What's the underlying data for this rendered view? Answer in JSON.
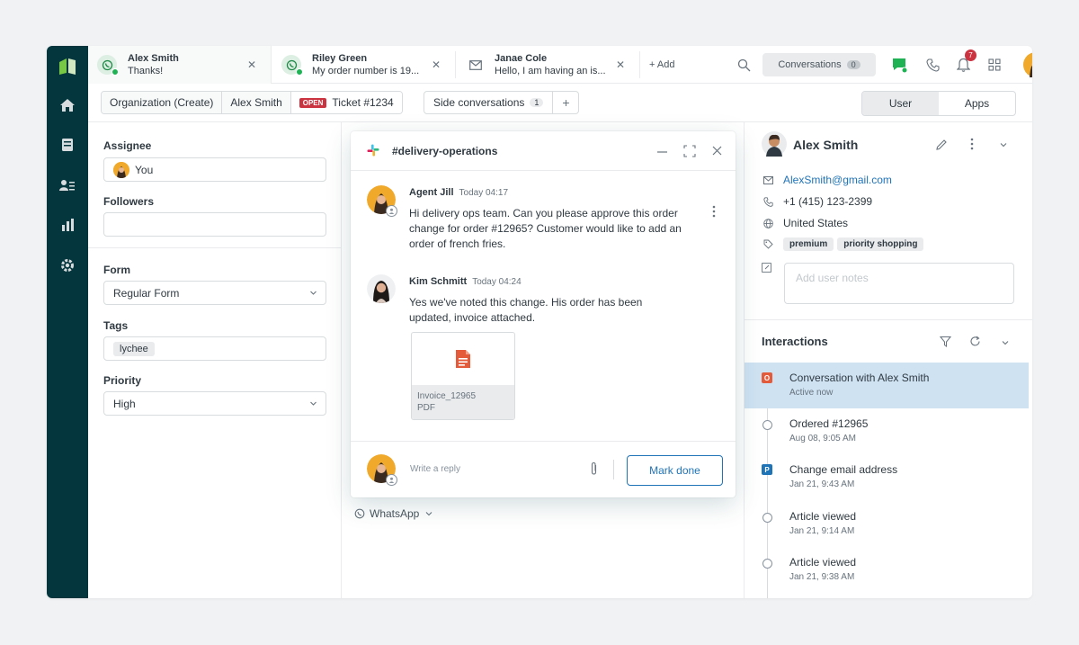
{
  "colors": {
    "rail": "#03363d",
    "accent": "#1f73b7",
    "danger": "#cc3340",
    "whatsapp": "#1fb254",
    "active_row": "#cee2f2"
  },
  "tabs": [
    {
      "name": "Alex Smith",
      "preview": "Thanks!",
      "icon": "whatsapp-icon"
    },
    {
      "name": "Riley Green",
      "preview": "My order number is 19...",
      "icon": "whatsapp-icon"
    },
    {
      "name": "Janae Cole",
      "preview": "Hello, I am having an is...",
      "icon": "mail-icon"
    }
  ],
  "topbar": {
    "add_label": "+ Add",
    "conversations_label": "Conversations",
    "conversations_count": "0",
    "notifications_count": "7"
  },
  "breadcrumb": {
    "org": "Organization (Create)",
    "user": "Alex Smith",
    "status": "OPEN",
    "ticket": "Ticket #1234"
  },
  "side_conversations": {
    "label": "Side conversations",
    "count": "1",
    "plus": "+"
  },
  "segmented": {
    "user": "User",
    "apps": "Apps"
  },
  "left": {
    "assignee_label": "Assignee",
    "assignee_value": "You",
    "followers_label": "Followers",
    "followers_value": "",
    "form_label": "Form",
    "form_value": "Regular Form",
    "tags_label": "Tags",
    "tag": "lychee",
    "priority_label": "Priority",
    "priority_value": "High"
  },
  "center": {
    "channel": "WhatsApp"
  },
  "popup": {
    "title": "#delivery-operations",
    "messages": [
      {
        "author": "Agent Jill",
        "time": "Today 04:17",
        "text": "Hi delivery ops team. Can you please approve this order change for order #12965? Customer would like to add an order of french fries."
      },
      {
        "author": "Kim Schmitt",
        "time": "Today 04:24",
        "text": "Yes we've noted this change. His order has been updated, invoice attached."
      }
    ],
    "attachment": {
      "name": "Invoice_12965",
      "type": "PDF"
    },
    "reply_placeholder": "Write a reply",
    "mark_done": "Mark done"
  },
  "right": {
    "name": "Alex Smith",
    "email": "AlexSmith@gmail.com",
    "phone": "+1 (415) 123-2399",
    "country": "United States",
    "tags": [
      "premium",
      "priority shopping"
    ],
    "notes_placeholder": "Add user notes",
    "interactions_title": "Interactions",
    "interactions": [
      {
        "marker": "O",
        "title": "Conversation with Alex Smith",
        "sub": "Active now"
      },
      {
        "marker": "",
        "title": "Ordered #12965",
        "sub": "Aug 08, 9:05 AM"
      },
      {
        "marker": "P",
        "title": "Change email address",
        "sub": "Jan 21, 9:43 AM"
      },
      {
        "marker": "",
        "title": "Article viewed",
        "sub": "Jan 21, 9:14 AM"
      },
      {
        "marker": "",
        "title": "Article viewed",
        "sub": "Jan 21, 9:38 AM"
      }
    ]
  }
}
